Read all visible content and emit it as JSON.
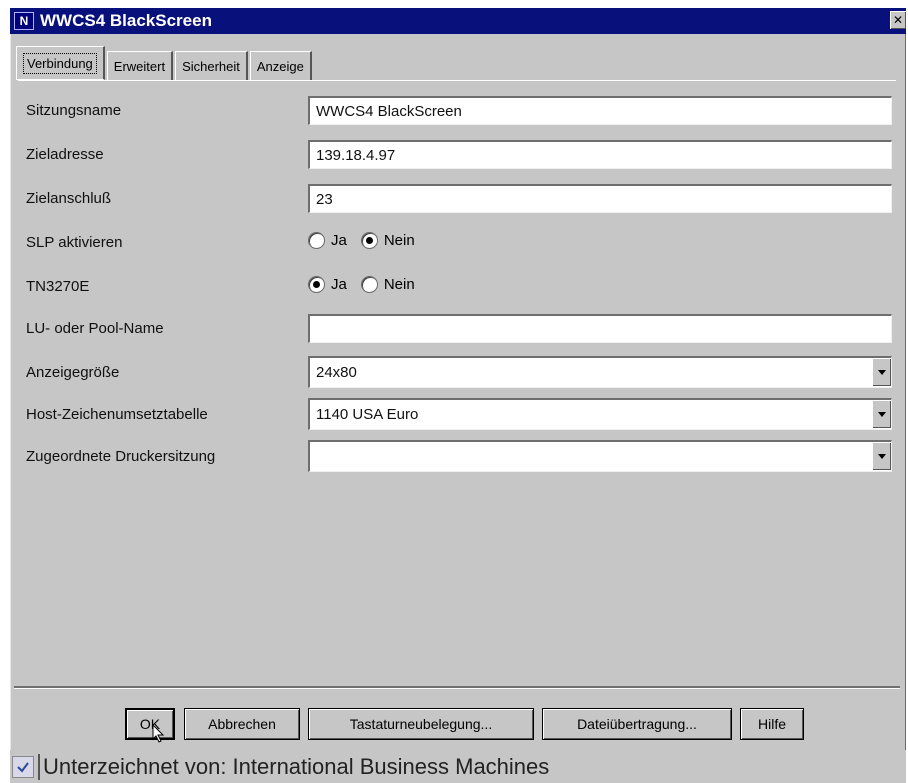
{
  "window": {
    "title": "WWCS4 BlackScreen",
    "app_icon_glyph": "N",
    "close_glyph": "✕"
  },
  "tabs": [
    {
      "label": "Verbindung",
      "active": true
    },
    {
      "label": "Erweitert",
      "active": false
    },
    {
      "label": "Sicherheit",
      "active": false
    },
    {
      "label": "Anzeige",
      "active": false
    }
  ],
  "form": {
    "session_name": {
      "label": "Sitzungsname",
      "value": "WWCS4 BlackScreen"
    },
    "target_address": {
      "label": "Zieladresse",
      "value": "139.18.4.97"
    },
    "target_port": {
      "label": "Zielanschluß",
      "value": "23"
    },
    "slp": {
      "label": "SLP aktivieren",
      "yes": "Ja",
      "no": "Nein",
      "selected": "Nein"
    },
    "tn3270e": {
      "label": "TN3270E",
      "yes": "Ja",
      "no": "Nein",
      "selected": "Ja"
    },
    "lu_pool": {
      "label": "LU- oder Pool-Name",
      "value": ""
    },
    "display_size": {
      "label": "Anzeigegröße",
      "value": "24x80"
    },
    "host_codepage": {
      "label": "Host-Zeichenumsetztabelle",
      "value": "1140 USA Euro"
    },
    "printer_session": {
      "label": "Zugeordnete Druckersitzung",
      "value": ""
    }
  },
  "buttons": {
    "ok": "OK",
    "cancel": "Abbrechen",
    "keyboard": "Tastaturneubelegung...",
    "file_transfer": "Dateiübertragung...",
    "help": "Hilfe"
  },
  "statusbar": {
    "text": "Unterzeichnet von:  International Business Machines",
    "icon": "certificate-icon"
  },
  "colors": {
    "title_bar": "#08107c",
    "window_bg": "#c6c6c6"
  }
}
